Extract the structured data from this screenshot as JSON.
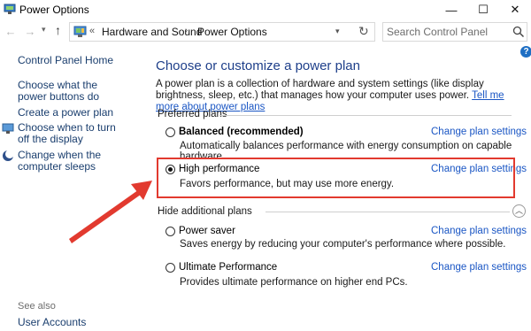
{
  "window": {
    "title": "Power Options",
    "minimize_glyph": "—",
    "maximize_glyph": "☐",
    "close_glyph": "✕"
  },
  "navigation": {
    "back_glyph": "←",
    "forward_glyph": "→",
    "dropdown_glyph": "▾",
    "up_glyph": "↑",
    "breadcrumb_chevron": "«",
    "breadcrumb": [
      "Hardware and Sound",
      "Power Options"
    ],
    "separator": "›",
    "address_dropdown_glyph": "▾",
    "refresh_glyph": "↻",
    "search_placeholder": "Search Control Panel"
  },
  "help": {
    "glyph": "?"
  },
  "sidebar": {
    "home": "Control Panel Home",
    "links": [
      "Choose what the power buttons do",
      "Create a power plan",
      "Choose when to turn off the display",
      "Change when the computer sleeps"
    ],
    "see_also": "See also",
    "user_accounts": "User Accounts"
  },
  "main": {
    "title": "Choose or customize a power plan",
    "description": "A power plan is a collection of hardware and system settings (like display brightness, sleep, etc.) that manages how your computer uses power.",
    "description_link": "Tell me more about power plans",
    "preferred_label": "Preferred plans",
    "hidden_label": "Hide additional plans",
    "collapse_glyph": "︿",
    "plans": [
      {
        "name": "Balanced (recommended)",
        "description": "Automatically balances performance with energy consumption on capable hardware.",
        "link": "Change plan settings",
        "selected": false
      },
      {
        "name": "High performance",
        "description": "Favors performance, but may use more energy.",
        "link": "Change plan settings",
        "selected": true
      },
      {
        "name": "Power saver",
        "description": "Saves energy by reducing your computer's performance where possible.",
        "link": "Change plan settings",
        "selected": false
      },
      {
        "name": "Ultimate Performance",
        "description": "Provides ultimate performance on higher end PCs.",
        "link": "Change plan settings",
        "selected": false
      }
    ]
  },
  "colors": {
    "link": "#1a56c4",
    "title": "#1e3f8a",
    "annotation": "#e23a2f"
  },
  "icons": {
    "app": "power-options-icon",
    "address": "control-panel-icon",
    "search": "search-icon",
    "display": "display-power-icon",
    "sleep": "sleep-moon-icon"
  }
}
